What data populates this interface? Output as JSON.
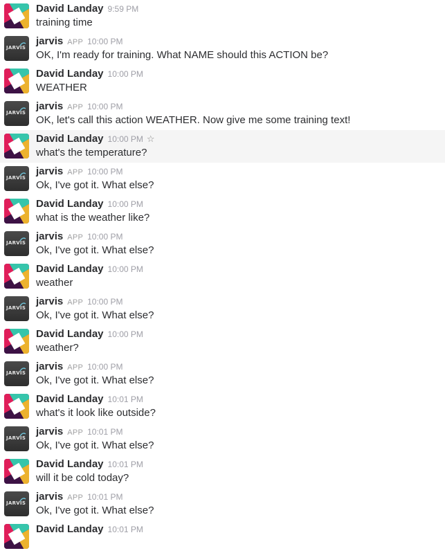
{
  "bot_avatar_text": "JARVIS",
  "colors": {
    "slack_red": "#e01e5a",
    "slack_teal": "#36c5ab",
    "slack_yellow": "#ecb22e",
    "slack_dark": "#3d1245",
    "hover_bg": "#f5f5f5"
  },
  "messages": [
    {
      "sender": "David Landay",
      "app": "",
      "time": "9:59 PM",
      "text": "training time",
      "avatar": "slack-logo"
    },
    {
      "sender": "jarvis",
      "app": "APP",
      "time": "10:00 PM",
      "text": "OK, I'm ready for training. What NAME should this ACTION be?",
      "avatar": "jarvis-logo"
    },
    {
      "sender": "David Landay",
      "app": "",
      "time": "10:00 PM",
      "text": "WEATHER",
      "avatar": "slack-logo"
    },
    {
      "sender": "jarvis",
      "app": "APP",
      "time": "10:00 PM",
      "text": "OK, let's call this action WEATHER. Now give me some training text!",
      "avatar": "jarvis-logo"
    },
    {
      "sender": "David Landay",
      "app": "",
      "time": "10:00 PM",
      "text": "what's the temperature?",
      "avatar": "slack-logo",
      "hovered": true,
      "star": "☆"
    },
    {
      "sender": "jarvis",
      "app": "APP",
      "time": "10:00 PM",
      "text": "Ok, I've got it. What else?",
      "avatar": "jarvis-logo"
    },
    {
      "sender": "David Landay",
      "app": "",
      "time": "10:00 PM",
      "text": "what is the weather like?",
      "avatar": "slack-logo"
    },
    {
      "sender": "jarvis",
      "app": "APP",
      "time": "10:00 PM",
      "text": "Ok, I've got it. What else?",
      "avatar": "jarvis-logo"
    },
    {
      "sender": "David Landay",
      "app": "",
      "time": "10:00 PM",
      "text": "weather",
      "avatar": "slack-logo"
    },
    {
      "sender": "jarvis",
      "app": "APP",
      "time": "10:00 PM",
      "text": "Ok, I've got it. What else?",
      "avatar": "jarvis-logo"
    },
    {
      "sender": "David Landay",
      "app": "",
      "time": "10:00 PM",
      "text": "weather?",
      "avatar": "slack-logo"
    },
    {
      "sender": "jarvis",
      "app": "APP",
      "time": "10:00 PM",
      "text": "Ok, I've got it. What else?",
      "avatar": "jarvis-logo"
    },
    {
      "sender": "David Landay",
      "app": "",
      "time": "10:01 PM",
      "text": "what's it look like outside?",
      "avatar": "slack-logo"
    },
    {
      "sender": "jarvis",
      "app": "APP",
      "time": "10:01 PM",
      "text": "Ok, I've got it. What else?",
      "avatar": "jarvis-logo"
    },
    {
      "sender": "David Landay",
      "app": "",
      "time": "10:01 PM",
      "text": "will it be cold today?",
      "avatar": "slack-logo"
    },
    {
      "sender": "jarvis",
      "app": "APP",
      "time": "10:01 PM",
      "text": "Ok, I've got it. What else?",
      "avatar": "jarvis-logo"
    },
    {
      "sender": "David Landay",
      "app": "",
      "time": "10:01 PM",
      "text": "",
      "avatar": "slack-logo"
    }
  ]
}
